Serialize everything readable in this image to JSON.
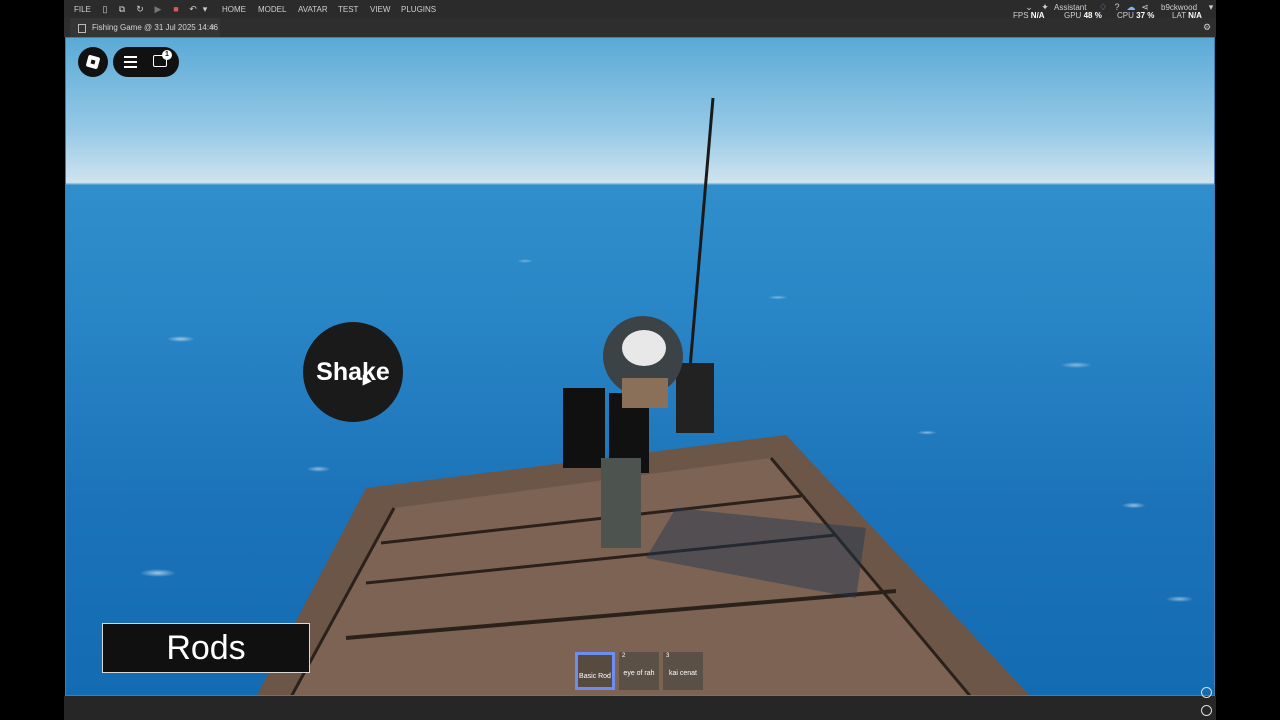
{
  "menu": {
    "file": "FILE",
    "tabs": [
      "HOME",
      "MODEL",
      "AVATAR",
      "TEST",
      "VIEW",
      "PLUGINS"
    ]
  },
  "toolbar_icons": [
    "new-file-icon",
    "open-icon",
    "redo-icon",
    "play-icon",
    "stop-icon",
    "undo-icon",
    "dropdown-icon"
  ],
  "right_bar": {
    "assistant": "Assistant",
    "user": "b9ckwood"
  },
  "stats": {
    "fps_label": "FPS",
    "fps_value": "N/A",
    "gpu_label": "GPU",
    "gpu_value": "48 %",
    "cpu_label": "CPU",
    "cpu_value": "37 %",
    "lat_label": "LAT",
    "lat_value": "N/A"
  },
  "document_tab": {
    "title": "Fishing Game @ 31 Jul 2025 14:46",
    "close": "×"
  },
  "game": {
    "chat_badge": "1",
    "shake_label": "Shake",
    "rods_label": "Rods",
    "hotbar": [
      {
        "num": "",
        "name": "Basic Rod",
        "selected": true
      },
      {
        "num": "2",
        "name": "eye of rah",
        "selected": false
      },
      {
        "num": "3",
        "name": "kai cenat",
        "selected": false
      }
    ]
  },
  "colors": {
    "studio_dark": "#2b2b2b",
    "sky": "#95c9e6",
    "ocean": "#1c73b9",
    "hotbar_select": "#6d8df0"
  }
}
